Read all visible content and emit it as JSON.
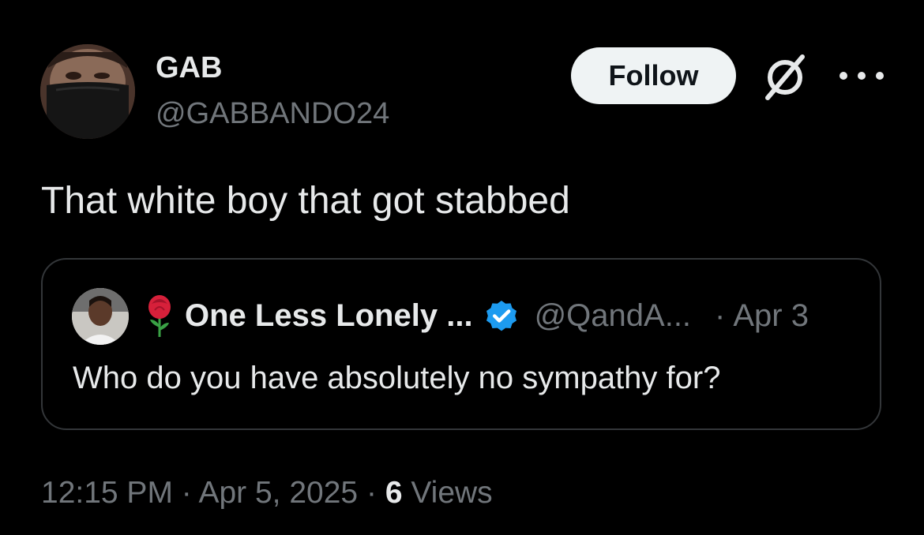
{
  "author": {
    "display_name": "GAB",
    "handle": "@GABBANDO24"
  },
  "actions": {
    "follow_label": "Follow",
    "grok_icon": "grok-icon",
    "more_icon": "more-options-icon"
  },
  "tweet": {
    "text": "That white boy that got stabbed",
    "time": "12:15 PM",
    "date": "Apr 5, 2025",
    "separator": "·",
    "views_count": "6",
    "views_label": "Views"
  },
  "quoted": {
    "emoji_icon": "rose-icon",
    "display_name": "One Less Lonely ...",
    "verified_icon": "verified-badge-icon",
    "handle": "@QandA...",
    "separator": "·",
    "date": "Apr 3",
    "text": "Who do you have absolutely no sympathy for?"
  },
  "colors": {
    "background": "#000000",
    "primary_text": "#e7e9ea",
    "secondary_text": "#71767b",
    "follow_bg": "#eff3f4",
    "verified_blue": "#1d9bf0",
    "card_border": "#333639"
  }
}
